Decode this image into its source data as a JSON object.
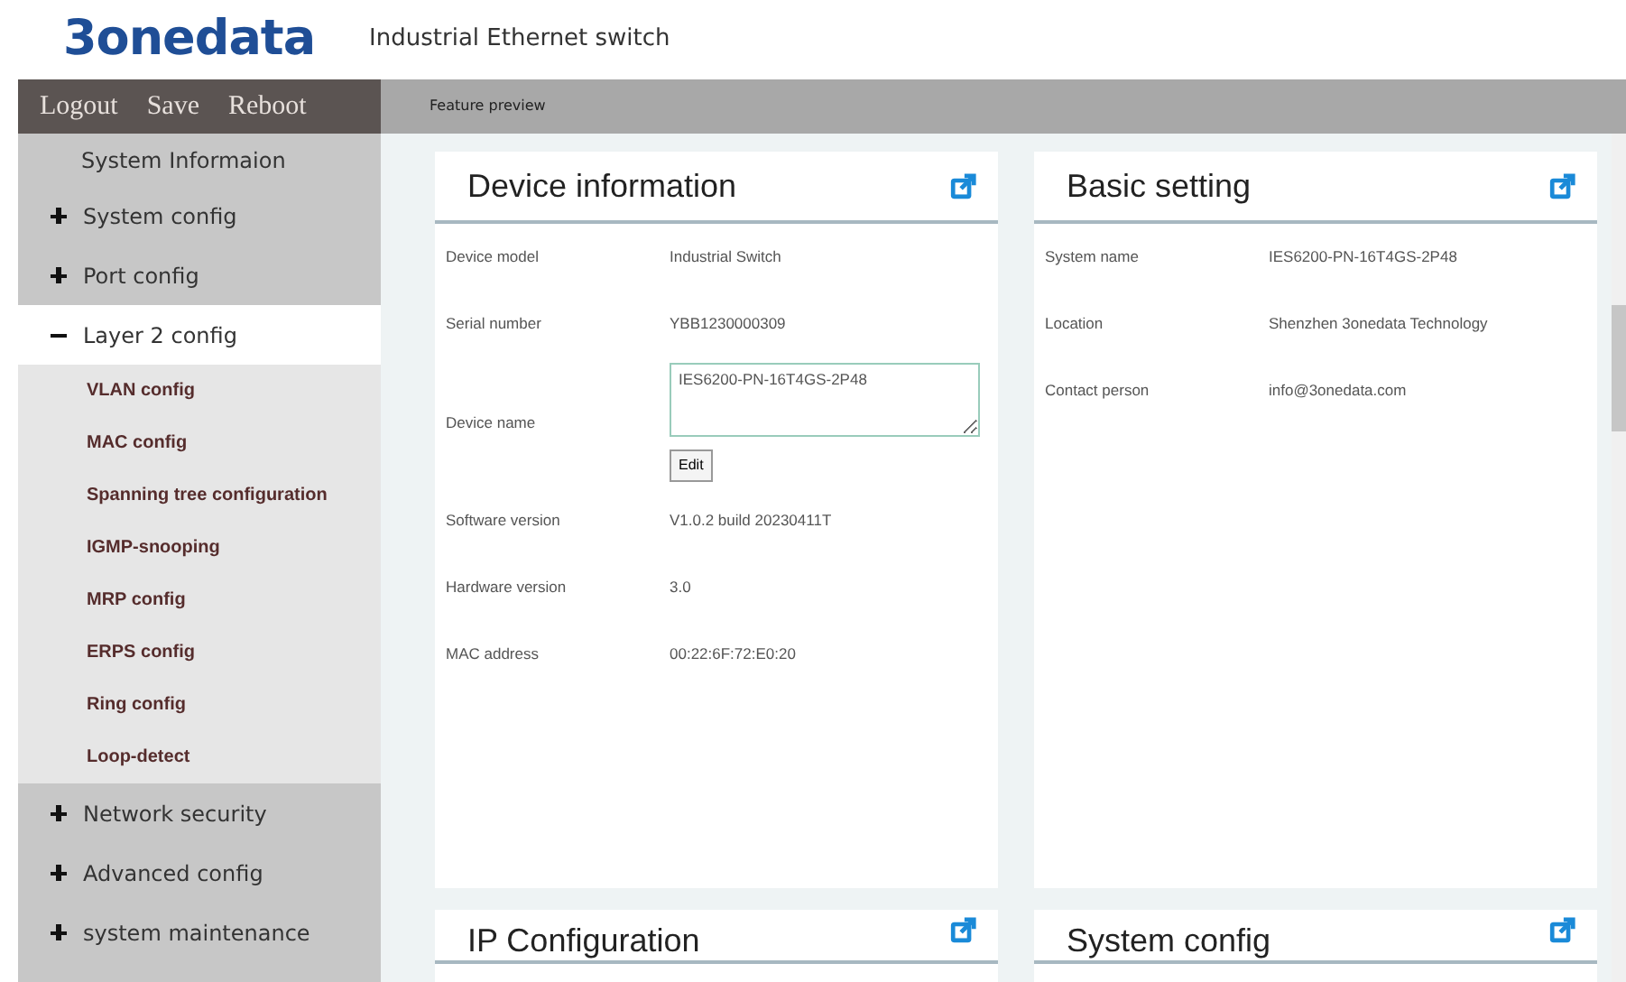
{
  "header": {
    "logo": "3onedata",
    "product": "Industrial Ethernet switch"
  },
  "top_actions": [
    "Logout",
    "Save",
    "Reboot"
  ],
  "breadcrumb": "Feature preview",
  "sidebar": {
    "items": [
      {
        "label": "System Informaion",
        "kind": "leaf",
        "selected": false
      },
      {
        "label": "System config",
        "kind": "group",
        "expanded": false
      },
      {
        "label": "Port config",
        "kind": "group",
        "expanded": false
      },
      {
        "label": "Layer 2 config",
        "kind": "group",
        "expanded": true,
        "children": [
          {
            "label": "VLAN config",
            "kind": "leaf",
            "selected": false
          },
          {
            "label": "MAC config",
            "kind": "leaf",
            "selected": false
          },
          {
            "label": "Spanning tree configuration",
            "kind": "leaf",
            "selected": false
          },
          {
            "label": "IGMP-snooping",
            "kind": "leaf",
            "selected": false
          },
          {
            "label": "MRP config",
            "kind": "leaf",
            "selected": false
          },
          {
            "label": "ERPS config",
            "kind": "leaf",
            "selected": false
          },
          {
            "label": "Ring config",
            "kind": "leaf",
            "selected": false
          },
          {
            "label": "Loop-detect",
            "kind": "leaf",
            "selected": false
          }
        ]
      },
      {
        "label": "Network security",
        "kind": "group",
        "expanded": false
      },
      {
        "label": "Advanced config",
        "kind": "group",
        "expanded": false
      },
      {
        "label": "system maintenance",
        "kind": "group",
        "expanded": false
      }
    ]
  },
  "panels": [
    {
      "title": "Device information",
      "rows": [
        {
          "label": "Device model",
          "value": "Industrial Switch",
          "kind": "text"
        },
        {
          "label": "Serial number",
          "value": "YBB1230000309",
          "kind": "text"
        },
        {
          "label": "Device name",
          "value": "IES6200-PN-16T4GS-2P48",
          "kind": "textarea",
          "button": "Edit"
        },
        {
          "label": "Software version",
          "value": "V1.0.2 build 20230411T",
          "kind": "text"
        },
        {
          "label": "Hardware version",
          "value": "3.0",
          "kind": "text"
        },
        {
          "label": "MAC address",
          "value": "00:22:6F:72:E0:20",
          "kind": "text"
        }
      ]
    },
    {
      "title": "Basic setting",
      "rows": [
        {
          "label": "System name",
          "value": "IES6200-PN-16T4GS-2P48",
          "kind": "text"
        },
        {
          "label": "Location",
          "value": "Shenzhen 3onedata Technology",
          "kind": "text"
        },
        {
          "label": "Contact person",
          "value": "info@3onedata.com",
          "kind": "text"
        }
      ]
    },
    {
      "title": "IP Configuration"
    },
    {
      "title": "System config"
    }
  ]
}
